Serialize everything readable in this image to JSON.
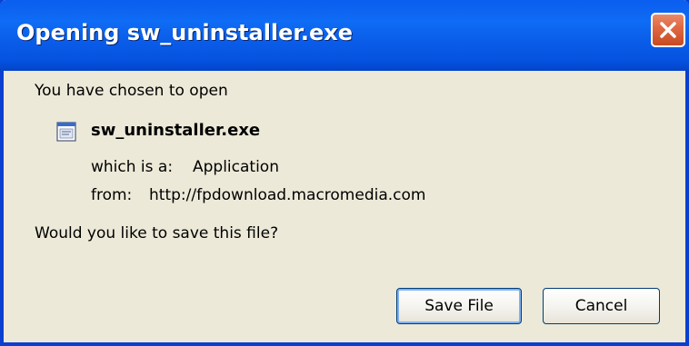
{
  "dialog": {
    "title": "Opening sw_uninstaller.exe",
    "intro": "You have chosen to open",
    "file_name": "sw_uninstaller.exe",
    "type_label": "which is a:",
    "type_value": "Application",
    "from_label": "from:",
    "from_value": "http://fpdownload.macromedia.com",
    "question": "Would you like to save this file?"
  },
  "buttons": {
    "save_label": "Save File",
    "cancel_label": "Cancel"
  },
  "icons": {
    "close": "close-icon",
    "file": "application-file-icon"
  },
  "colors": {
    "titlebar": "#0a5ef0",
    "dialog_background": "#ece9d8",
    "close_button": "#e06a44"
  }
}
